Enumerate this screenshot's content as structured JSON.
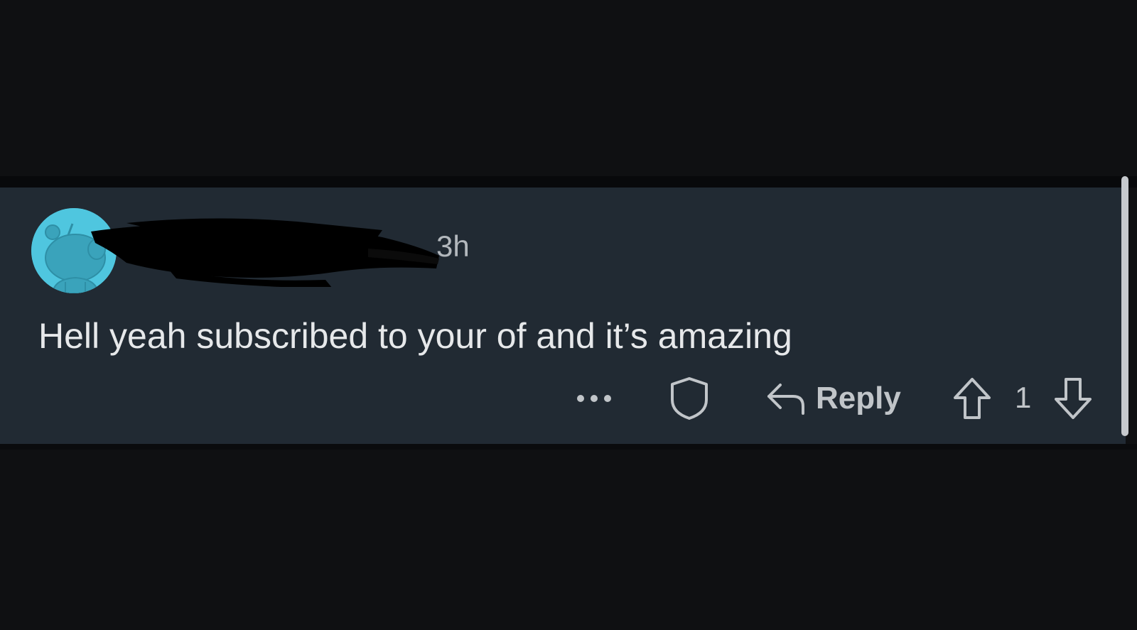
{
  "comment": {
    "username": "",
    "timestamp": "3h",
    "body": "Hell yeah subscribed to your of and it’s amazing",
    "avatar_icon": "snoo-avatar-icon",
    "avatar_color": "#4fc6df"
  },
  "actions": {
    "more_icon": "more-options-icon",
    "award_icon": "shield-icon",
    "reply_icon": "reply-arrow-icon",
    "reply_label": "Reply",
    "upvote_icon": "upvote-arrow-icon",
    "vote_count": "1",
    "downvote_icon": "downvote-arrow-icon"
  },
  "colors": {
    "background": "#0f1012",
    "card": "#212a33",
    "text_primary": "#e6e8ea",
    "text_secondary": "#b3b8bd"
  }
}
